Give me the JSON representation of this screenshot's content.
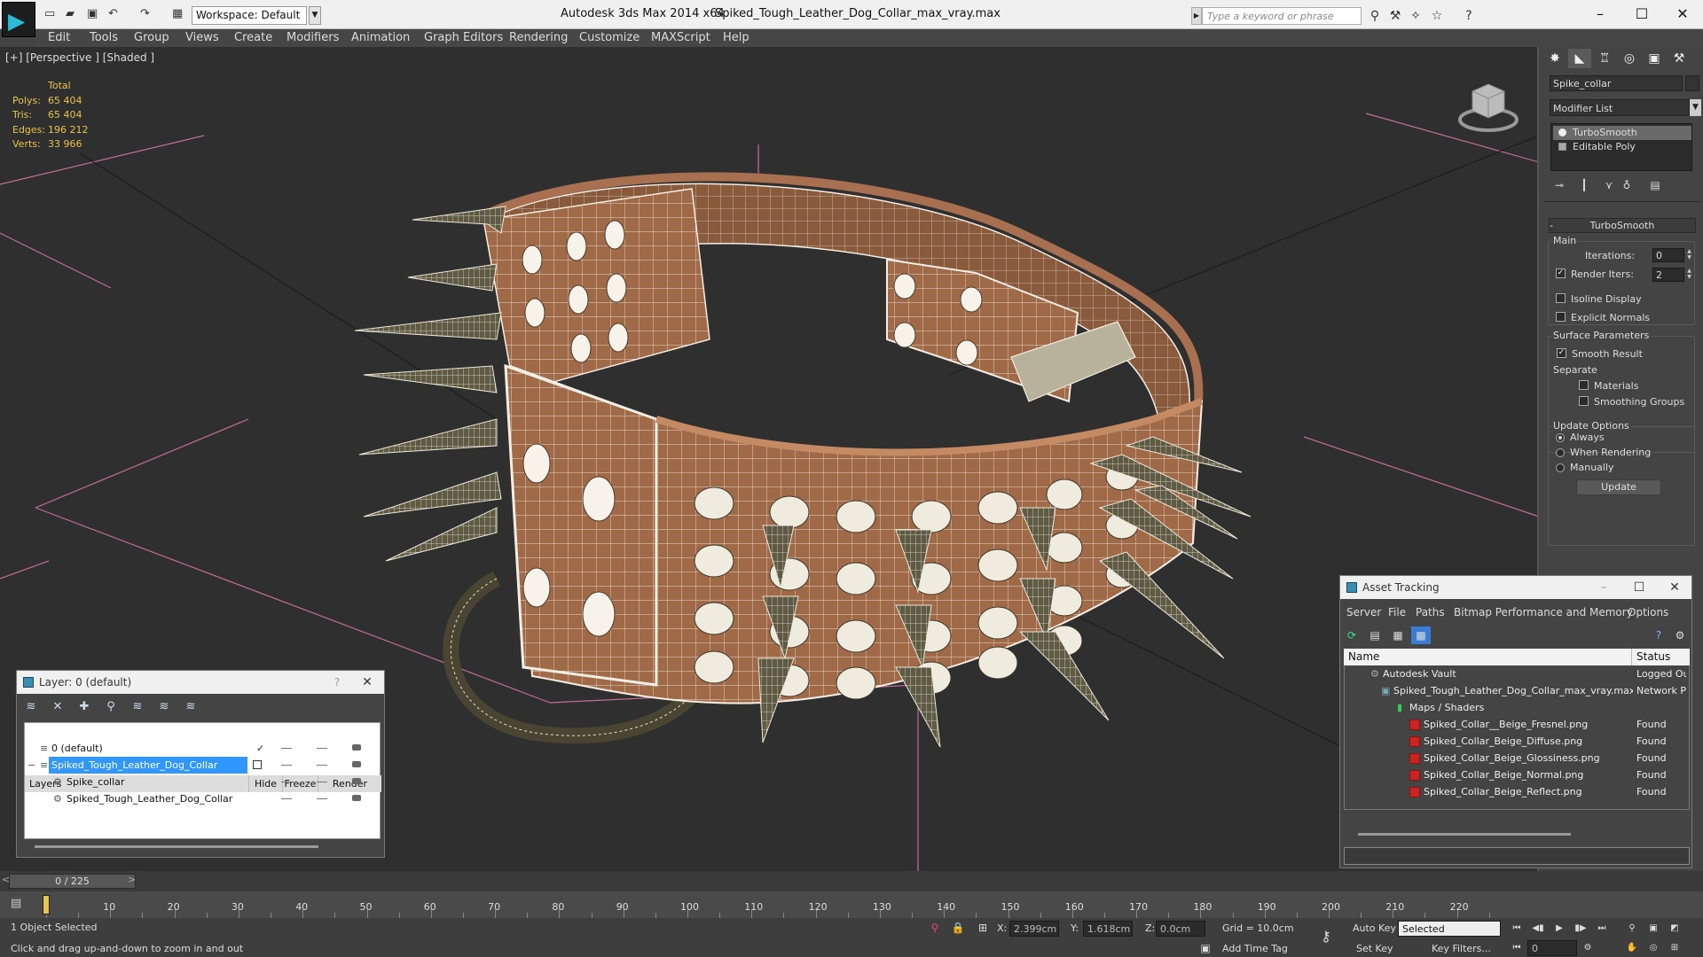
{
  "window": {
    "app_title": "Autodesk 3ds Max  2014 x64",
    "file_title": "Spiked_Tough_Leather_Dog_Collar_max_vray.max",
    "workspace_label": "Workspace: Default",
    "search_placeholder": "Type a keyword or phrase"
  },
  "menu": [
    "Edit",
    "Tools",
    "Group",
    "Views",
    "Create",
    "Modifiers",
    "Animation",
    "Graph Editors",
    "Rendering",
    "Customize",
    "MAXScript",
    "Help"
  ],
  "viewport": {
    "label": "[+] [Perspective ] [Shaded ]",
    "stats_header": "Total",
    "stats": [
      {
        "key": "Polys:",
        "value": "65 404"
      },
      {
        "key": "Tris:",
        "value": "65 404"
      },
      {
        "key": "Edges:",
        "value": "196 212"
      },
      {
        "key": "Verts:",
        "value": "33 966"
      }
    ],
    "colors": {
      "leather": "#a06a48",
      "wire": "#f3ede4",
      "spike": "#5f5a44",
      "grid": "#d77aa8",
      "bg": "#2f2f2f"
    }
  },
  "command_panel": {
    "object_name": "Spike_collar",
    "modifier_list": "Modifier List",
    "stack": [
      "TurboSmooth",
      "Editable Poly"
    ],
    "rollout_title": "TurboSmooth",
    "main_group": "Main",
    "iterations_label": "Iterations:",
    "iterations_value": "0",
    "render_iters_label": "Render Iters:",
    "render_iters_value": "2",
    "isoline_label": "Isoline Display",
    "explicit_normals_label": "Explicit Normals",
    "surface_group": "Surface Parameters",
    "smooth_result_label": "Smooth Result",
    "separate_label": "Separate",
    "materials_label": "Materials",
    "smoothing_groups_label": "Smoothing Groups",
    "update_group": "Update Options",
    "update_options": [
      "Always",
      "When Rendering",
      "Manually"
    ],
    "update_button": "Update"
  },
  "layer_dialog": {
    "title": "Layer: 0 (default)",
    "columns": [
      "Layers",
      "Hide",
      "Freeze",
      "Render"
    ],
    "rows": [
      "0 (default)",
      "Spiked_Tough_Leather_Dog_Collar",
      "Spike_collar",
      "Spiked_Tough_Leather_Dog_Collar"
    ]
  },
  "asset_tracking": {
    "title": "Asset Tracking",
    "menu": [
      "Server",
      "File",
      "Paths",
      "Bitmap Performance and Memory",
      "Options"
    ],
    "columns": [
      "Name",
      "Status"
    ],
    "rows": [
      {
        "name": "Autodesk Vault",
        "status": "Logged Ou"
      },
      {
        "name": "Spiked_Tough_Leather_Dog_Collar_max_vray.max",
        "status": "Network P"
      },
      {
        "name": "Maps / Shaders",
        "status": ""
      },
      {
        "name": "Spiked_Collar__Beige_Fresnel.png",
        "status": "Found"
      },
      {
        "name": "Spiked_Collar_Beige_Diffuse.png",
        "status": "Found"
      },
      {
        "name": "Spiked_Collar_Beige_Glossiness.png",
        "status": "Found"
      },
      {
        "name": "Spiked_Collar_Beige_Normal.png",
        "status": "Found"
      },
      {
        "name": "Spiked_Collar_Beige_Reflect.png",
        "status": "Found"
      }
    ]
  },
  "timeline": {
    "slider": "0 / 225",
    "ticks": [
      "10",
      "20",
      "30",
      "40",
      "50",
      "60",
      "70",
      "80",
      "90",
      "100",
      "110",
      "120",
      "130",
      "140",
      "150",
      "160",
      "170",
      "180",
      "190",
      "200",
      "210",
      "220"
    ]
  },
  "status": {
    "selection": "1 Object Selected",
    "prompt": "Click and drag up-and-down to zoom in and out",
    "x_label": "X:",
    "x_value": "2.399cm",
    "y_label": "Y:",
    "y_value": "1.618cm",
    "z_label": "Z:",
    "z_value": "0.0cm",
    "grid": "Grid = 10.0cm",
    "add_time_tag": "Add Time Tag",
    "auto_key": "Auto Key",
    "set_key": "Set Key",
    "selected_option": "Selected",
    "key_filters": "Key Filters...",
    "frame": "0"
  }
}
